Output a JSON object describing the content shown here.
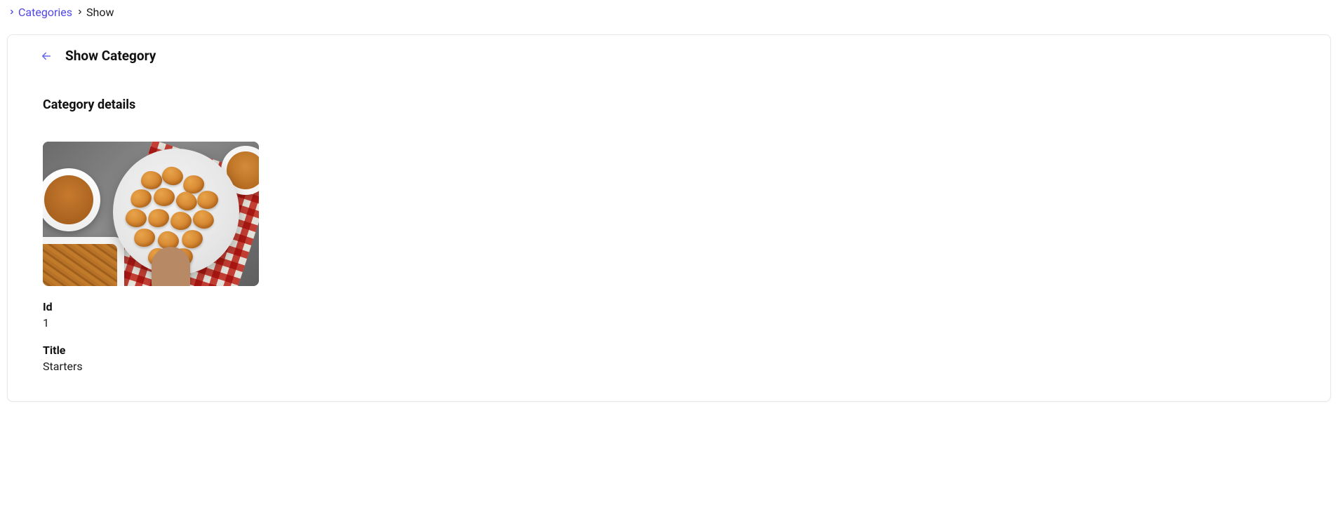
{
  "breadcrumb": {
    "link_label": "Categories",
    "current_label": "Show"
  },
  "page": {
    "title": "Show Category",
    "section_title": "Category details"
  },
  "fields": {
    "id_label": "Id",
    "id_value": "1",
    "title_label": "Title",
    "title_value": "Starters"
  }
}
